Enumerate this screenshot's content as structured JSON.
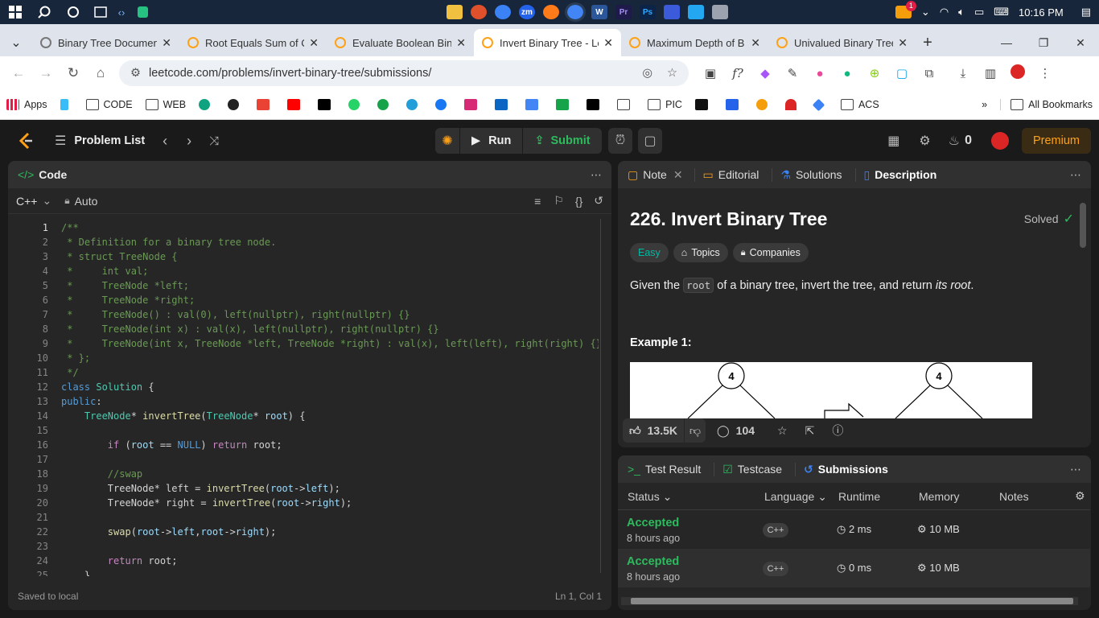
{
  "taskbar": {
    "time": "10:16 PM",
    "notif_count": "1"
  },
  "tabs": [
    {
      "title": "Binary Tree Documen",
      "active": false
    },
    {
      "title": "Root Equals Sum of C",
      "active": false
    },
    {
      "title": "Evaluate Boolean Bina",
      "active": false
    },
    {
      "title": "Invert Binary Tree - Le",
      "active": true
    },
    {
      "title": "Maximum Depth of B",
      "active": false
    },
    {
      "title": "Univalued Binary Tree",
      "active": false
    }
  ],
  "address": {
    "url": "leetcode.com/problems/invert-binary-tree/submissions/"
  },
  "bookmarks": [
    "Apps",
    "CODE",
    "WEB",
    "PIC",
    "ACS"
  ],
  "bookmarks_all": "All Bookmarks",
  "lcnav": {
    "problem_list": "Problem List",
    "run": "Run",
    "submit": "Submit",
    "streak": "0",
    "premium": "Premium"
  },
  "code_panel": {
    "title": "Code",
    "language": "C++",
    "autocomplete": "Auto",
    "status_left": "Saved to local",
    "status_right": "Ln 1, Col 1"
  },
  "desc_panel": {
    "tabs": [
      "Note",
      "Editorial",
      "Solutions",
      "Description"
    ],
    "problem_title": "226. Invert Binary Tree",
    "status": "Solved",
    "difficulty": "Easy",
    "topics": "Topics",
    "companies": "Companies",
    "desc_prefix": "Given the",
    "desc_code": "root",
    "desc_mid": "of a binary tree, invert the tree, and return",
    "desc_em": "its root",
    "example_label": "Example 1:",
    "tree_root_left": "4",
    "tree_root_right": "4",
    "likes": "13.5K",
    "comments": "104"
  },
  "result_panel": {
    "tabs": [
      "Test Result",
      "Testcase",
      "Submissions"
    ],
    "columns": [
      "Status",
      "Language",
      "Runtime",
      "Memory",
      "Notes"
    ],
    "rows": [
      {
        "status": "Accepted",
        "time": "8 hours ago",
        "language": "C++",
        "runtime": "2 ms",
        "memory": "10 MB"
      },
      {
        "status": "Accepted",
        "time": "8 hours ago",
        "language": "C++",
        "runtime": "0 ms",
        "memory": "10 MB"
      }
    ]
  },
  "colors": {
    "accepted": "#2cbb5d",
    "easy": "#00b8a3",
    "premium": "#ffa116",
    "link_blue": "#569cd6"
  }
}
